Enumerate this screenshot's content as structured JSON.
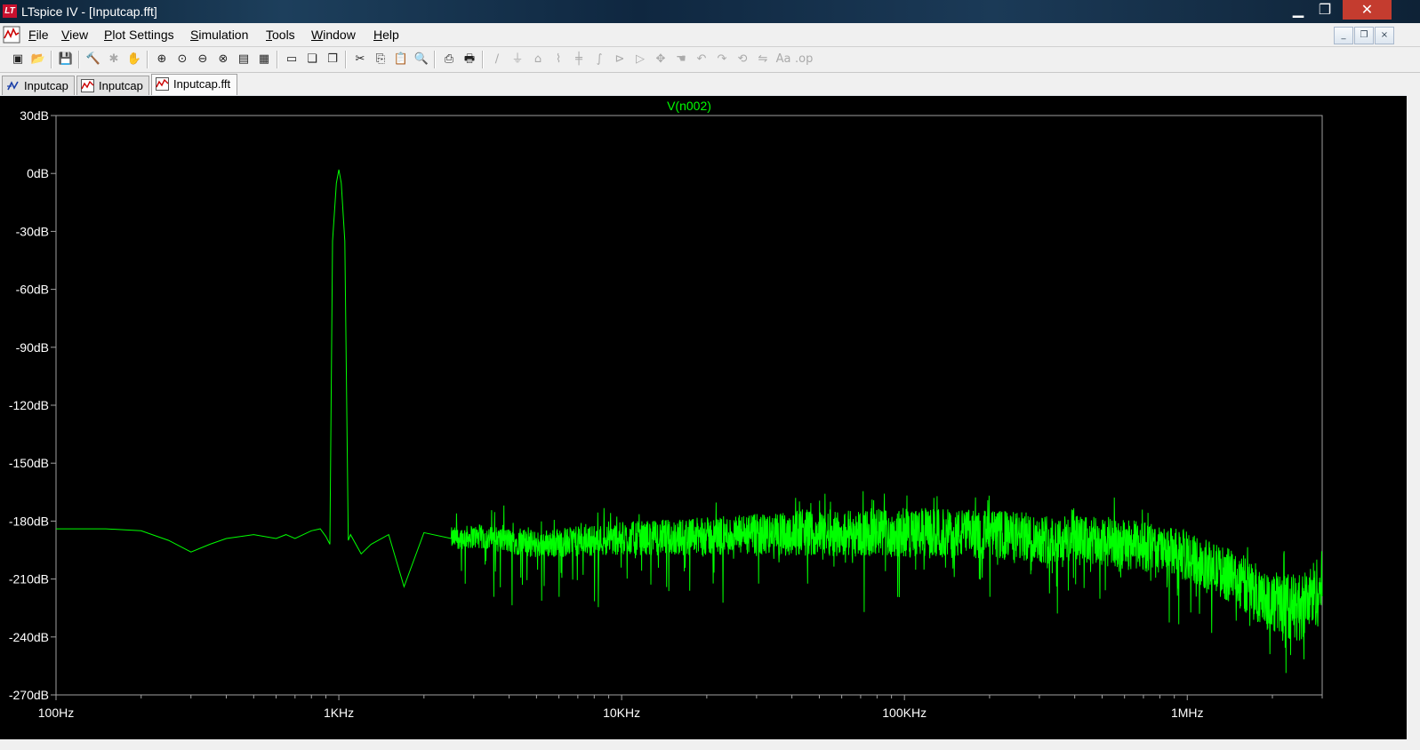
{
  "window": {
    "title": "LTspice IV - [Inputcap.fft]",
    "logo_text": "LT",
    "controls": {
      "minimize": "▁",
      "restore": "❐",
      "close": "✕"
    }
  },
  "menu": {
    "items": [
      "File",
      "View",
      "Plot Settings",
      "Simulation",
      "Tools",
      "Window",
      "Help"
    ],
    "mdi_controls": {
      "minimize": "_",
      "restore": "❐",
      "close": "×"
    }
  },
  "toolbar": {
    "buttons": [
      {
        "name": "new-schematic-icon",
        "glyph": "▣",
        "enabled": true
      },
      {
        "name": "open-icon",
        "glyph": "📂",
        "enabled": true
      },
      {
        "name": "save-icon",
        "glyph": "💾",
        "enabled": true
      },
      {
        "name": "control-panel-icon",
        "glyph": "🔨",
        "enabled": true
      },
      {
        "name": "run-icon",
        "glyph": "✱",
        "enabled": false
      },
      {
        "name": "halt-icon",
        "glyph": "✋",
        "enabled": false
      },
      {
        "name": "zoom-in-icon",
        "glyph": "⊕",
        "enabled": true
      },
      {
        "name": "zoom-pan-icon",
        "glyph": "⊙",
        "enabled": true
      },
      {
        "name": "zoom-out-icon",
        "glyph": "⊖",
        "enabled": true
      },
      {
        "name": "zoom-fit-icon",
        "glyph": "⊗",
        "enabled": true
      },
      {
        "name": "autorange-icon",
        "glyph": "▤",
        "enabled": true
      },
      {
        "name": "set-manual-limits-icon",
        "glyph": "▦",
        "enabled": true
      },
      {
        "name": "tile-horizontal-icon",
        "glyph": "▭",
        "enabled": true
      },
      {
        "name": "cascade-icon",
        "glyph": "❏",
        "enabled": true
      },
      {
        "name": "tile-vertical-icon",
        "glyph": "❐",
        "enabled": true
      },
      {
        "name": "cut-icon",
        "glyph": "✂",
        "enabled": true
      },
      {
        "name": "copy-icon",
        "glyph": "⎘",
        "enabled": true
      },
      {
        "name": "paste-icon",
        "glyph": "📋",
        "enabled": true
      },
      {
        "name": "find-icon",
        "glyph": "🔍",
        "enabled": true
      },
      {
        "name": "print-preview-icon",
        "glyph": "⎙",
        "enabled": true
      },
      {
        "name": "print-icon",
        "glyph": "🖶",
        "enabled": true
      },
      {
        "name": "draw-wire-icon",
        "glyph": "∕",
        "enabled": false
      },
      {
        "name": "ground-icon",
        "glyph": "⏚",
        "enabled": false
      },
      {
        "name": "label-net-icon",
        "glyph": "⌂",
        "enabled": false
      },
      {
        "name": "resistor-icon",
        "glyph": "⌇",
        "enabled": false
      },
      {
        "name": "capacitor-icon",
        "glyph": "╪",
        "enabled": false
      },
      {
        "name": "inductor-icon",
        "glyph": "∫",
        "enabled": false
      },
      {
        "name": "diode-icon",
        "glyph": "⊳",
        "enabled": false
      },
      {
        "name": "component-icon",
        "glyph": "▷",
        "enabled": false
      },
      {
        "name": "move-icon",
        "glyph": "✥",
        "enabled": false
      },
      {
        "name": "drag-icon",
        "glyph": "☚",
        "enabled": false
      },
      {
        "name": "undo-icon",
        "glyph": "↶",
        "enabled": false
      },
      {
        "name": "redo-icon",
        "glyph": "↷",
        "enabled": false
      },
      {
        "name": "rotate-icon",
        "glyph": "⟲",
        "enabled": false
      },
      {
        "name": "mirror-icon",
        "glyph": "⇋",
        "enabled": false
      },
      {
        "name": "text-icon",
        "glyph": "Aa",
        "enabled": false
      },
      {
        "name": "spice-directive-icon",
        "glyph": ".op",
        "enabled": false
      }
    ]
  },
  "tabs": [
    {
      "label": "Inputcap",
      "icon": "schematic-icon",
      "active": false
    },
    {
      "label": "Inputcap",
      "icon": "waveform-icon",
      "active": false
    },
    {
      "label": "Inputcap.fft",
      "icon": "waveform-icon",
      "active": true
    }
  ],
  "colors": {
    "trace": "#00ff00",
    "axis": "#a0a0a0",
    "tick_text": "#ffffff",
    "background": "#000000"
  },
  "chart_data": {
    "type": "line",
    "title": "V(n002)",
    "xlabel": "",
    "ylabel": "",
    "x_scale": "log",
    "x_unit": "Hz",
    "xlim": [
      100,
      3000000
    ],
    "ylim": [
      -270,
      30
    ],
    "yticks": [
      "30dB",
      "0dB",
      "-30dB",
      "-60dB",
      "-90dB",
      "-120dB",
      "-150dB",
      "-180dB",
      "-210dB",
      "-240dB",
      "-270dB"
    ],
    "xticks": [
      {
        "value": 100,
        "label": "100Hz"
      },
      {
        "value": 1000,
        "label": "1KHz"
      },
      {
        "value": 10000,
        "label": "10KHz"
      },
      {
        "value": 100000,
        "label": "100KHz"
      },
      {
        "value": 1000000,
        "label": "1MHz"
      }
    ],
    "grid": false,
    "series": [
      {
        "name": "V(n002)",
        "points": [
          [
            100,
            -184
          ],
          [
            150,
            -184
          ],
          [
            200,
            -185
          ],
          [
            250,
            -190
          ],
          [
            300,
            -196
          ],
          [
            350,
            -192
          ],
          [
            400,
            -189
          ],
          [
            500,
            -187
          ],
          [
            600,
            -189
          ],
          [
            650,
            -187
          ],
          [
            700,
            -189
          ],
          [
            800,
            -185
          ],
          [
            860,
            -184
          ],
          [
            900,
            -188
          ],
          [
            930,
            -192
          ],
          [
            950,
            -35
          ],
          [
            980,
            -5
          ],
          [
            1000,
            2
          ],
          [
            1020,
            -5
          ],
          [
            1050,
            -35
          ],
          [
            1080,
            -190
          ],
          [
            1100,
            -187
          ],
          [
            1200,
            -197
          ],
          [
            1300,
            -192
          ],
          [
            1500,
            -187
          ],
          [
            1700,
            -214
          ],
          [
            2000,
            -186
          ],
          [
            2500,
            -189
          ],
          [
            3000,
            -188
          ],
          [
            5000,
            -192
          ],
          [
            10000,
            -189
          ],
          [
            20000,
            -188
          ],
          [
            50000,
            -186
          ],
          [
            100000,
            -186
          ],
          [
            200000,
            -187
          ],
          [
            400000,
            -190
          ],
          [
            700000,
            -193
          ],
          [
            1000000,
            -198
          ],
          [
            1500000,
            -210
          ],
          [
            2000000,
            -222
          ],
          [
            2500000,
            -225
          ],
          [
            3000000,
            -214
          ]
        ],
        "noise": true
      }
    ]
  }
}
